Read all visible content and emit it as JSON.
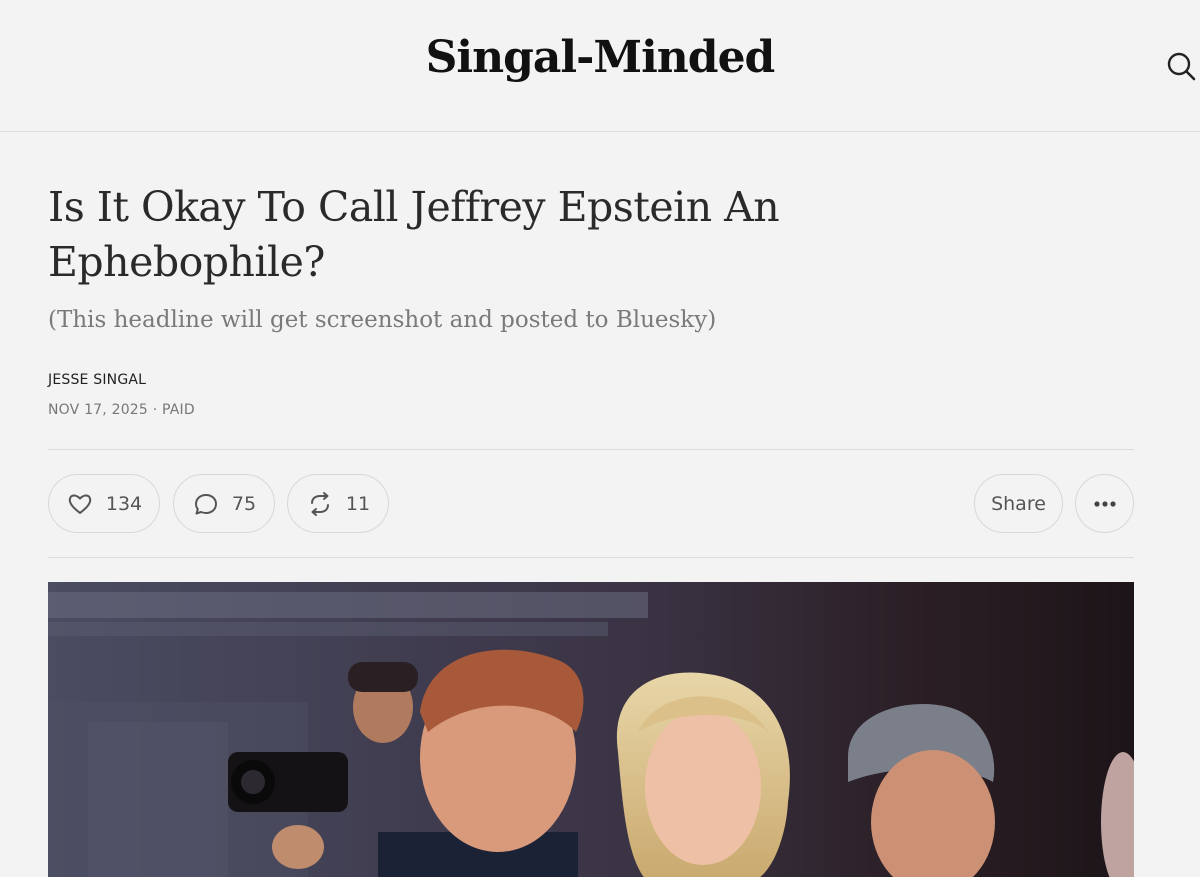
{
  "header": {
    "brand": "Singal-Minded",
    "search_icon": "search-icon"
  },
  "article": {
    "title": "Is It Okay To Call Jeffrey Epstein An Ephebophile?",
    "subtitle": "(This headline will get screenshot and posted to Bluesky)",
    "author": "JESSE SINGAL",
    "date": "NOV 17, 2025",
    "separator": "·",
    "access": "PAID"
  },
  "actions": {
    "likes": "134",
    "comments": "75",
    "restacks": "11",
    "share_label": "Share",
    "icons": [
      "heart-icon",
      "comment-icon",
      "restack-icon",
      "more-icon"
    ]
  },
  "colors": {
    "background": "#f3f3f3",
    "divider": "#dcdcdc",
    "subtitle": "#7a7a7a"
  }
}
